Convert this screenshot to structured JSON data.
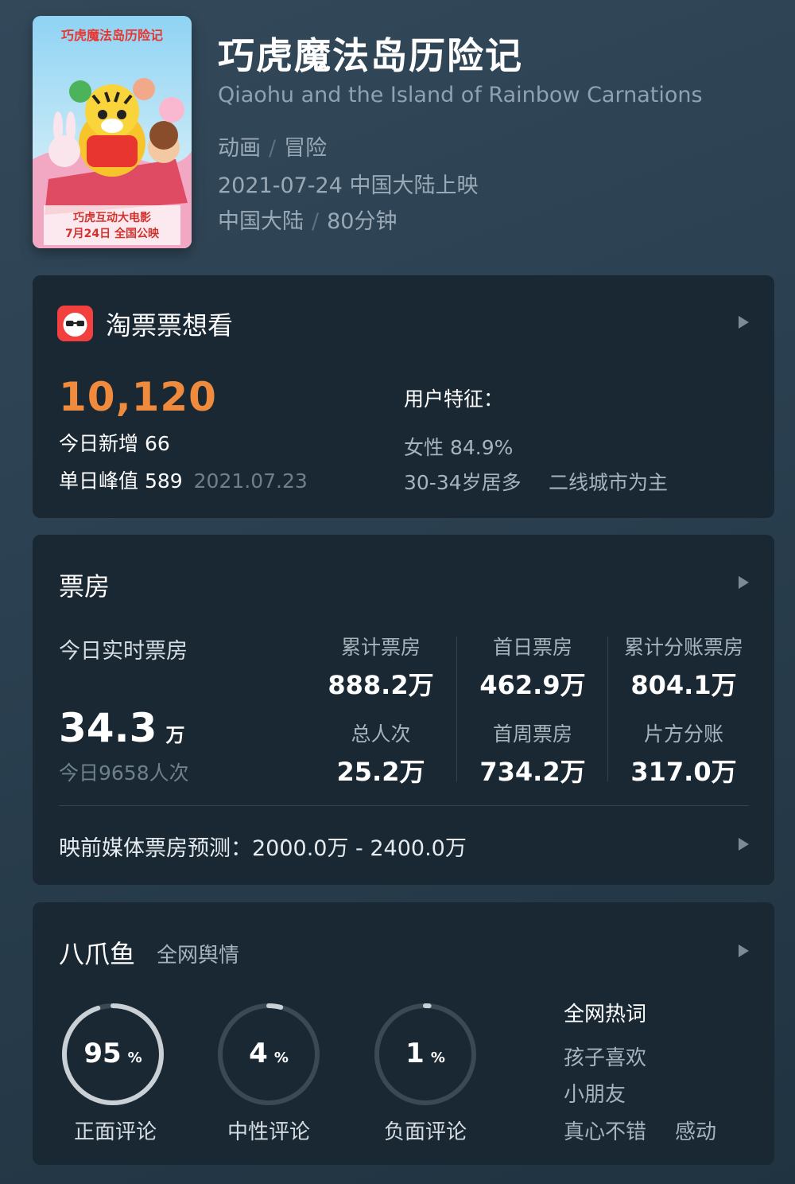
{
  "movie": {
    "title": "巧虎魔法岛历险记",
    "english_title": "Qiaohu and the Island of Rainbow Carnations",
    "genres": [
      "动画",
      "冒险"
    ],
    "release": "2021-07-24 中国大陆上映",
    "region": "中国大陆",
    "duration": "80分钟",
    "poster": {
      "title_text": "巧虎魔法岛历险记",
      "tagline": "巧虎互动大电影",
      "date": "7月24日 全国公映"
    }
  },
  "want": {
    "title": "淘票票想看",
    "icon": "taopiaopiao-logo-icon",
    "count": "10,120",
    "today_label": "今日新增",
    "today_value": "66",
    "peak_label": "单日峰值",
    "peak_value": "589",
    "peak_date": "2021.07.23",
    "user_title": "用户特征：",
    "female": "女性 84.9%",
    "age": "30-34岁居多",
    "city": "二线城市为主",
    "accent_color": "#f08a3c"
  },
  "boxoffice": {
    "title": "票房",
    "realtime_label": "今日实时票房",
    "realtime_value": "34.3",
    "realtime_unit": "万",
    "today_viewers": "今日9658人次",
    "stats": [
      {
        "label": "累计票房",
        "value": "888.2万"
      },
      {
        "label": "首日票房",
        "value": "462.9万"
      },
      {
        "label": "累计分账票房",
        "value": "804.1万"
      },
      {
        "label": "总人次",
        "value": "25.2万"
      },
      {
        "label": "首周票房",
        "value": "734.2万"
      },
      {
        "label": "片方分账",
        "value": "317.0万"
      }
    ],
    "forecast": "映前媒体票房预测：2000.0万 - 2400.0万"
  },
  "sentiment": {
    "title": "八爪鱼",
    "subtitle": "全网舆情",
    "rings": [
      {
        "value": "95",
        "unit": "%",
        "label": "正面评论",
        "fraction": 0.95
      },
      {
        "value": "4",
        "unit": "%",
        "label": "中性评论",
        "fraction": 0.04
      },
      {
        "value": "1",
        "unit": "%",
        "label": "负面评论",
        "fraction": 0.01
      }
    ],
    "hot_title": "全网热词",
    "hot_words": [
      "孩子喜欢",
      "小朋友",
      "真心不错",
      "感动"
    ]
  },
  "colors": {
    "card_bg": "#1a2833",
    "ring_track": "#3a4a55",
    "ring_fill": "#c9d0d6"
  }
}
